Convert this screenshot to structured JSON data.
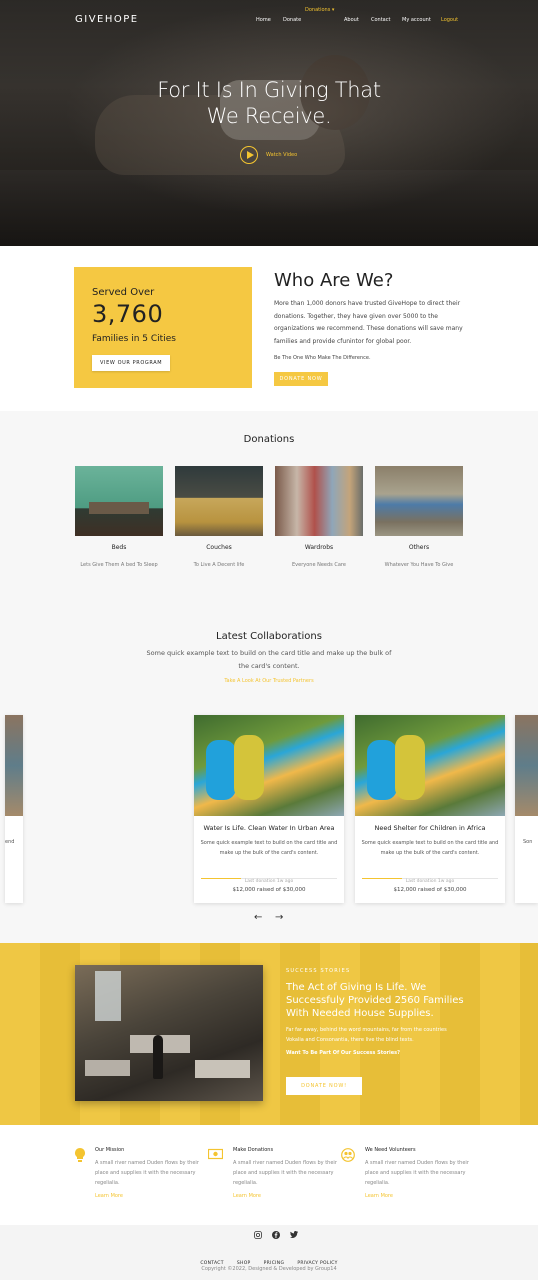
{
  "brand": "GIVEHOPE",
  "nav": {
    "dropdown": "Donations ▾",
    "items": [
      "Home",
      "Donate",
      "About",
      "Contact",
      "My account",
      "Logout"
    ]
  },
  "hero": {
    "title_line1": "For It Is In Giving That",
    "title_line2": "We Receive.",
    "watch": "Watch Video"
  },
  "served": {
    "line": "Served Over",
    "number": "3,760",
    "cities": "Families in 5 Cities",
    "button": "VIEW OUR PROGRAM"
  },
  "who": {
    "title": "Who Are We?",
    "text": "More than 1,000 donors have trusted GiveHope to direct their donations. Together, they have given over 5000 to the organizations we recommend. These donations will save many families and provide cfunintor for global poor.",
    "sub": "Be The One Who Make The Difference.",
    "button": "DONATE NOW"
  },
  "donations": {
    "title": "Donations",
    "items": [
      {
        "name": "Beds",
        "desc": "Lets Give Them A bed To Sleep"
      },
      {
        "name": "Couches",
        "desc": "To Live A Decent life"
      },
      {
        "name": "Wardrobs",
        "desc": "Everyone Needs Care"
      },
      {
        "name": "Others",
        "desc": "Whatever You Have To Give"
      }
    ]
  },
  "collab": {
    "title": "Latest Collaborations",
    "sub": "Some quick example text to build on the card title and make up the bulk of the card's content.",
    "link": "Take A Look At Our Trusted Partners",
    "cards": [
      {
        "title": "Water Is Life. Clean Water In Urban Area",
        "text": "Some quick example text to build on the card title and make up the bulk of the card's content.",
        "date": "Last donation 1w ago",
        "raised": "$12,000 raised of $30,000"
      },
      {
        "title": "Need Shelter for Children in Africa",
        "text": "Some quick example text to build on the card title and make up the bulk of the card's content.",
        "date": "Last donation 1w ago",
        "raised": "$12,000 raised of $30,000"
      }
    ],
    "partial_left_text": "end",
    "partial_right_text": "Son"
  },
  "success": {
    "label": "SUCCESS STORIES",
    "title": "The Act of Giving Is Life. We Successfuly Provided 2560 Families With Needed House Supplies.",
    "text": "Far far away, behind the word mountains, far from the countries Vokalia and Consonantia, there live the blind texts.",
    "question": "Want To Be Part Of Our Success Stories?",
    "button": "DONATE NOW!"
  },
  "features": [
    {
      "icon": "lightbulb-icon",
      "title": "Our Mission",
      "text": "A small river named Duden flows by their place and supplies it with the necessary regelialia.",
      "link": "Learn More"
    },
    {
      "icon": "money-icon",
      "title": "Make Donations",
      "text": "A small river named Duden flows by their place and supplies it with the necessary regelialia.",
      "link": "Learn More"
    },
    {
      "icon": "people-icon",
      "title": "We Need Volunteers",
      "text": "A small river named Duden flows by their place and supplies it with the necessary regelialia.",
      "link": "Learn More"
    }
  ],
  "footer": {
    "links": [
      "CONTACT",
      "SHOP",
      "PRICING",
      "PRIVACY POLICY"
    ],
    "copyright": "Copyright ©2022, Designed & Developed by Group14",
    "social": [
      "instagram-icon",
      "facebook-icon",
      "twitter-icon"
    ]
  },
  "colors": {
    "accent": "#f5c842",
    "dark": "#222222"
  }
}
